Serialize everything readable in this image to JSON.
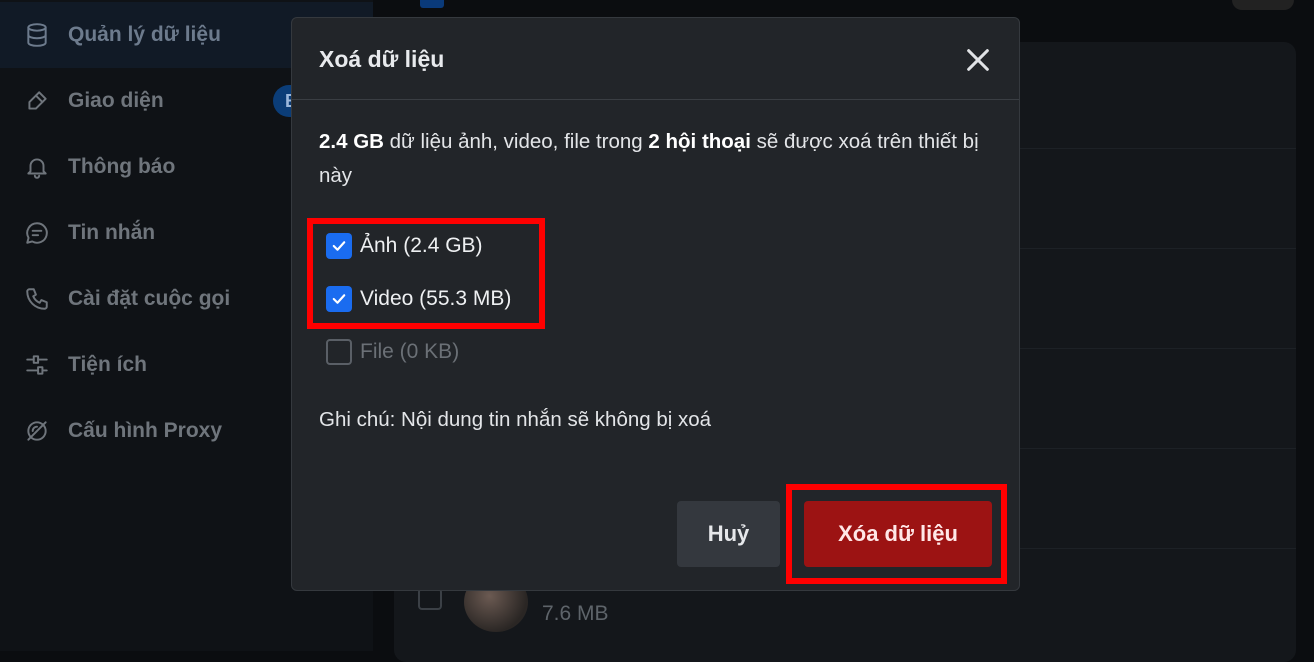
{
  "sidebar": {
    "items": [
      {
        "label": "Quản lý dữ liệu",
        "icon": "database-icon",
        "active": true
      },
      {
        "label": "Giao diện",
        "icon": "brush-icon",
        "active": false
      },
      {
        "label": "Thông báo",
        "icon": "bell-icon",
        "active": false
      },
      {
        "label": "Tin nhắn",
        "icon": "chat-bubble-icon",
        "active": false
      },
      {
        "label": "Cài đặt cuộc gọi",
        "icon": "phone-icon",
        "active": false
      },
      {
        "label": "Tiện ích",
        "icon": "sliders-icon",
        "active": false
      },
      {
        "label": "Cấu hình Proxy",
        "icon": "proxy-icon",
        "active": false
      }
    ],
    "badge": "B"
  },
  "background_row": {
    "size": "7.6 MB"
  },
  "dialog": {
    "title": "Xoá dữ liệu",
    "description": {
      "size": "2.4 GB",
      "part1": " dữ liệu ảnh, video, file trong ",
      "conversations": "2 hội thoại",
      "part2": " sẽ được xoá trên thiết bị này"
    },
    "options": [
      {
        "label": "Ảnh (2.4 GB)",
        "checked": true,
        "disabled": false
      },
      {
        "label": "Video (55.3 MB)",
        "checked": true,
        "disabled": false
      },
      {
        "label": "File (0 KB)",
        "checked": false,
        "disabled": true
      }
    ],
    "note": "Ghi chú: Nội dung tin nhắn sẽ không bị xoá",
    "cancel_label": "Huỷ",
    "confirm_label": "Xóa dữ liệu"
  },
  "colors": {
    "accent": "#1a6cf0",
    "danger": "#9c1313",
    "highlight": "#ff0000"
  }
}
